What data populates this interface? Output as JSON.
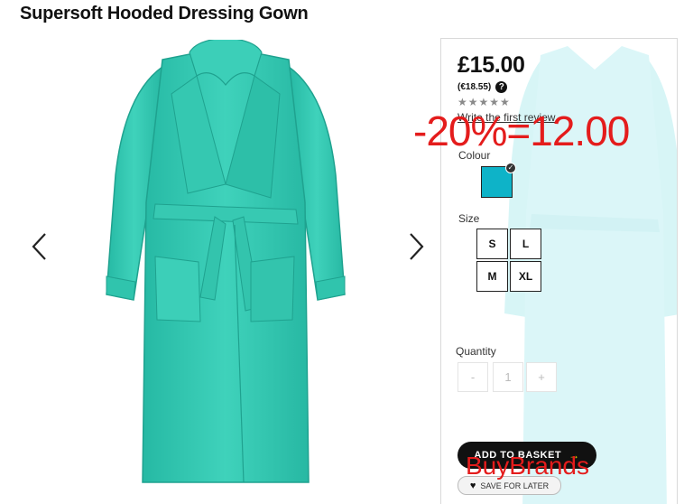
{
  "product": {
    "title": "Supersoft Hooded Dressing Gown",
    "image_icon": "dressing-gown-image",
    "colour_hex": "#2fc9b2"
  },
  "gallery": {
    "prev_icon": "chevron-left-icon",
    "next_icon": "chevron-right-icon"
  },
  "pricing": {
    "price": "£15.00",
    "euro_price": "(€18.55)",
    "help_icon": "?"
  },
  "reviews": {
    "stars": "★★★★★",
    "star_color": "#8a8a8a",
    "rating_fraction": 0,
    "write_review": "Write the first review"
  },
  "colour": {
    "label": "Colour",
    "selected_swatch_hex": "#0eb3c8"
  },
  "size": {
    "label": "Size",
    "options": [
      "S",
      "L",
      "M",
      "XL"
    ]
  },
  "quantity": {
    "label": "Quantity",
    "minus": "-",
    "value": "1",
    "plus": "+"
  },
  "actions": {
    "add_to_basket": "ADD TO BASKET",
    "add_arrow": "→",
    "save_for_later": "SAVE FOR LATER",
    "heart": "♥"
  },
  "overlays": {
    "discount_text": "-20%=12.00",
    "brand_text": "BuyBrands",
    "color": "#e41c1c"
  }
}
